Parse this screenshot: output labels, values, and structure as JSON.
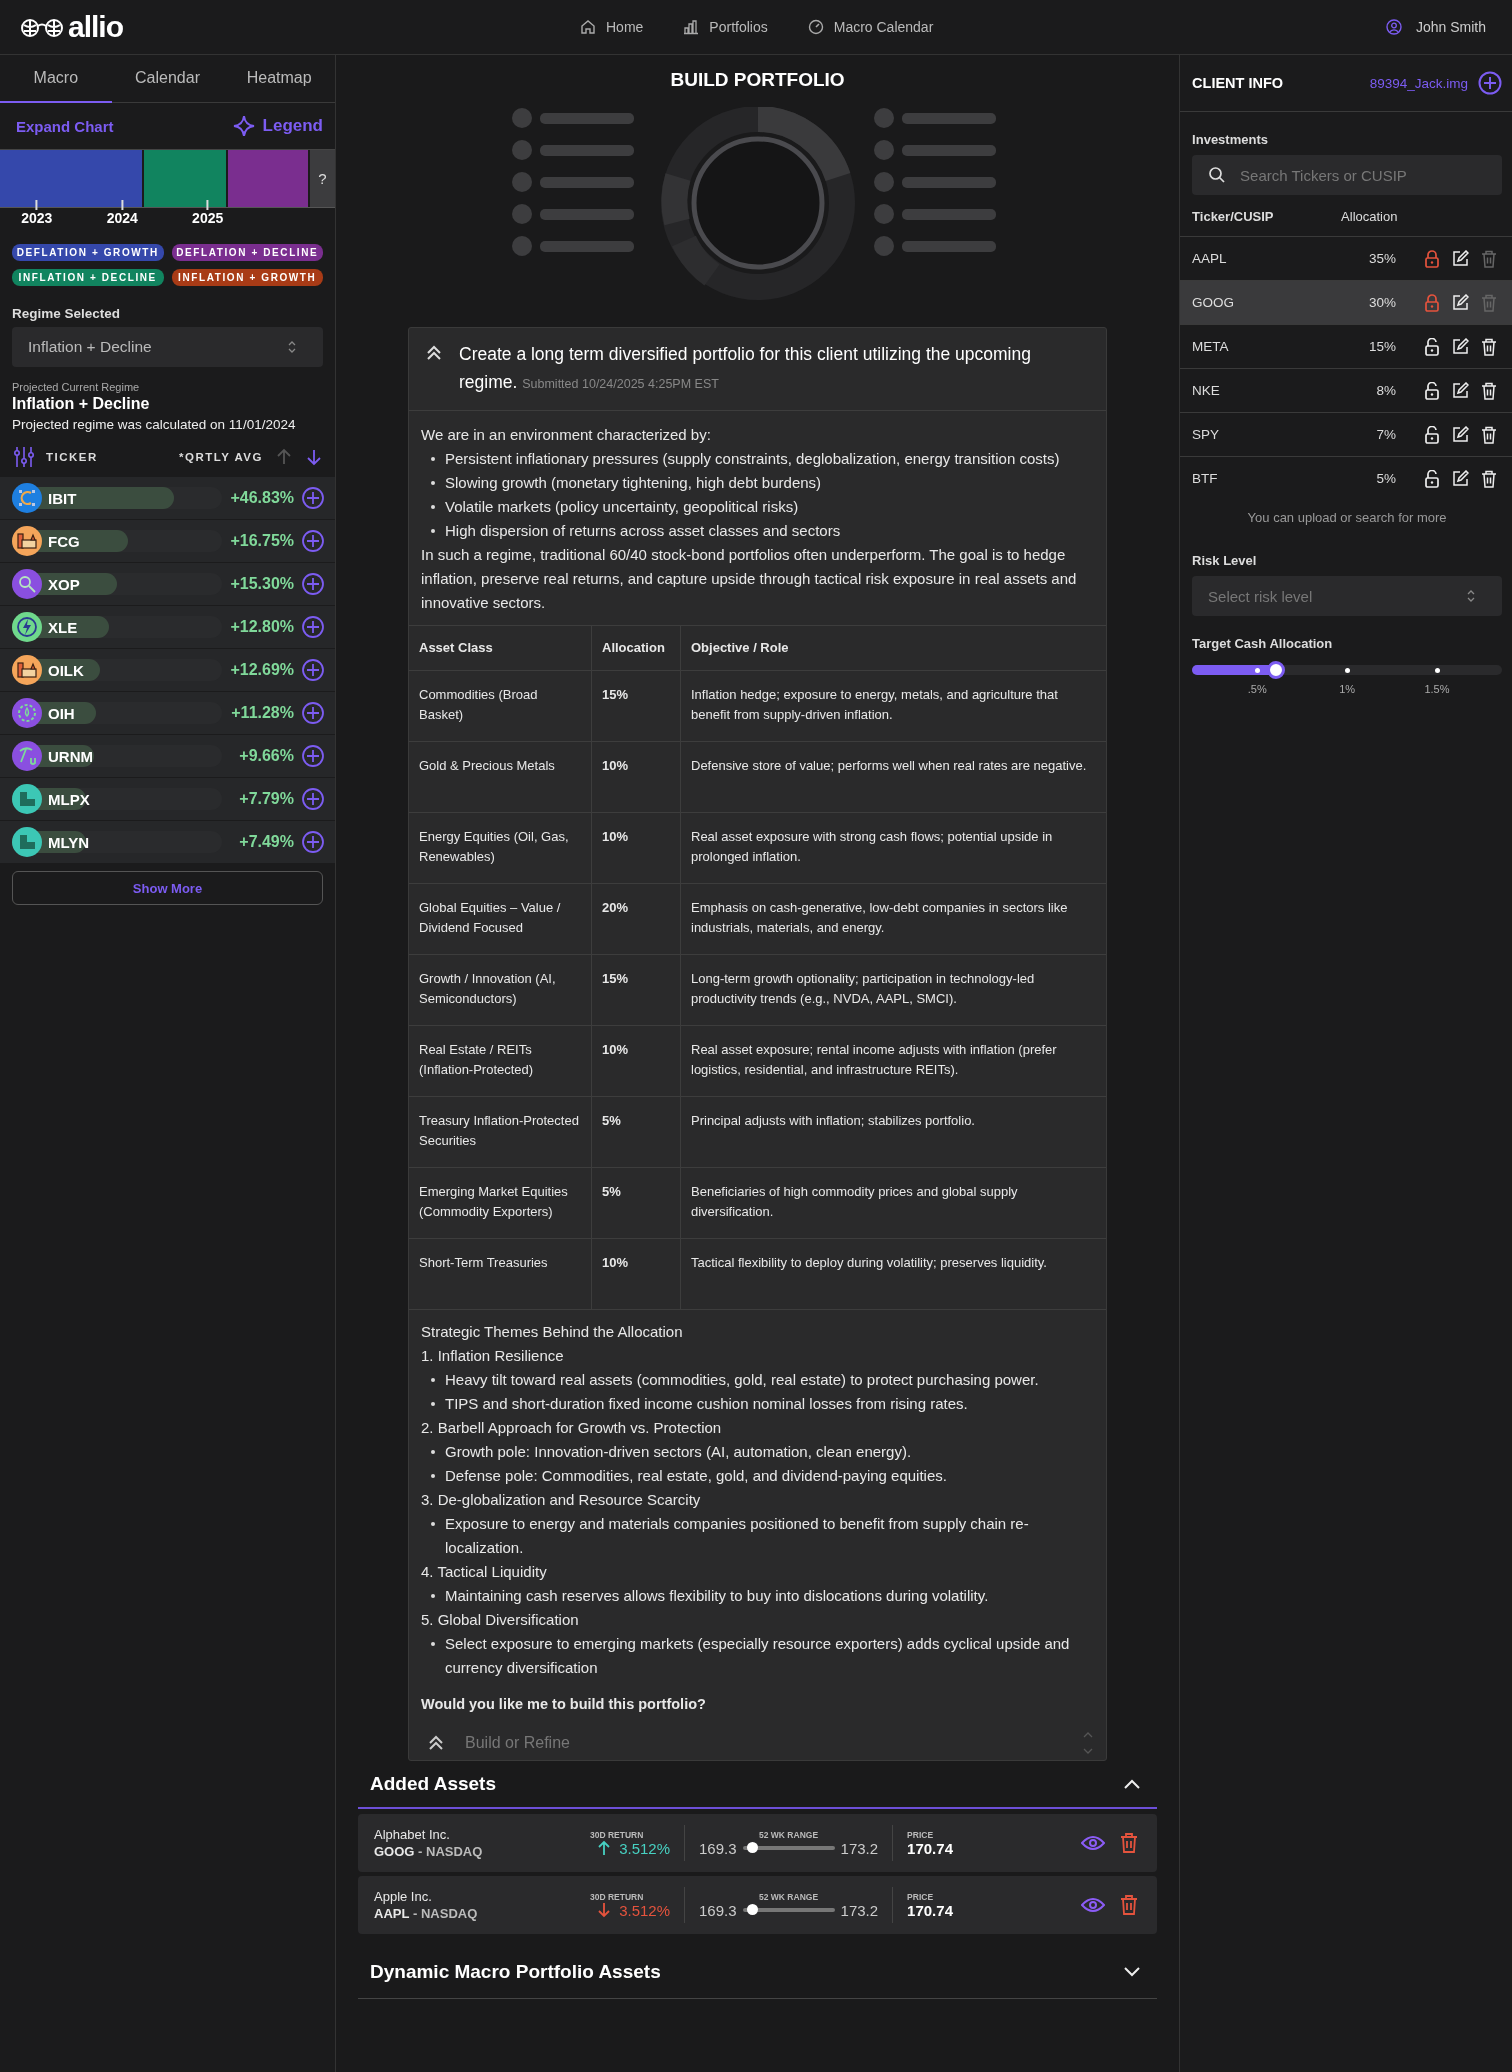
{
  "header": {
    "logo": "allio",
    "nav": [
      {
        "label": "Home",
        "kind": "home"
      },
      {
        "label": "Portfolios",
        "kind": "portfolios"
      },
      {
        "label": "Macro Calendar",
        "kind": "calendar"
      }
    ],
    "user": "John Smith"
  },
  "sidebar": {
    "tabs": [
      {
        "label": "Macro",
        "selected": true
      },
      {
        "label": "Calendar",
        "selected": false
      },
      {
        "label": "Heatmap",
        "selected": false
      }
    ],
    "expand_chart": "Expand Chart",
    "legend": "Legend",
    "regime_timeline": {
      "segments": [
        {
          "kind": "regime",
          "color": "#3548ab"
        },
        {
          "kind": "regime",
          "color": "#11845f"
        },
        {
          "kind": "regime",
          "color": "#7a2e8f"
        },
        {
          "kind": "unknown",
          "label": "?"
        }
      ],
      "years": [
        "2023",
        "2024",
        "2025"
      ]
    },
    "regimes": [
      {
        "label": "DEFLATION + GROWTH",
        "color": "#3548ab"
      },
      {
        "label": "DEFLATION + DECLINE",
        "color": "#7a2e8f"
      },
      {
        "label": "INFLATION + DECLINE",
        "color": "#11845f"
      },
      {
        "label": "INFLATION + GROWTH",
        "color": "#a83b16"
      }
    ],
    "regime_selected": {
      "label": "Regime Selected",
      "value": "Inflation + Decline"
    },
    "projected": {
      "label": "Projected Current Regime",
      "value": "Inflation + Decline",
      "note": "Projected regime was calculated on 11/01/2024"
    },
    "ticker_header": {
      "ticker": "TICKER",
      "average": "*QRTLY AVG",
      "sort_descending": true
    },
    "tickers": [
      {
        "symbol": "IBIT",
        "change": "+46.83%",
        "level": 0.77,
        "kind": "network",
        "color": "#1e7fe0"
      },
      {
        "symbol": "FCG",
        "change": "+16.75%",
        "level": 0.55,
        "kind": "factory",
        "color": "#f5a55a"
      },
      {
        "symbol": "XOP",
        "change": "+15.30%",
        "level": 0.5,
        "kind": "magnifier",
        "color": "#8a4fe0"
      },
      {
        "symbol": "XLE",
        "change": "+12.80%",
        "level": 0.46,
        "kind": "bolt",
        "color": "#6fd88c"
      },
      {
        "symbol": "OILK",
        "change": "+12.69%",
        "level": 0.42,
        "kind": "factory",
        "color": "#f5a55a"
      },
      {
        "symbol": "OIH",
        "change": "+11.28%",
        "level": 0.4,
        "kind": "gear",
        "color": "#8a4fe0"
      },
      {
        "symbol": "URNM",
        "change": "+9.66%",
        "level": 0.39,
        "kind": "pickaxe",
        "color": "#8a4fe0"
      },
      {
        "symbol": "MLPX",
        "change": "+7.79%",
        "level": 0.35,
        "kind": "buildings",
        "color": "#3cc7b5"
      },
      {
        "symbol": "MLYN",
        "change": "+7.49%",
        "level": 0.35,
        "kind": "buildings",
        "color": "#3cc7b5"
      }
    ],
    "show_more": "Show More"
  },
  "main": {
    "title": "BUILD PORTFOLIO",
    "prompt": {
      "text": "Create a long term diversified portfolio for this client utilizing the upcoming regime.",
      "submitted": "Submitted 10/24/2025 4:25PM EST"
    },
    "intro": "We are in an environment characterized by:",
    "bullets": [
      "Persistent inflationary pressures (supply constraints, deglobalization, energy transition costs)",
      "Slowing growth (monetary tightening, high debt burdens)",
      "Volatile markets (policy uncertainty, geopolitical risks)",
      "High dispersion of returns across asset classes and sectors"
    ],
    "paragraph": "In such a regime, traditional 60/40 stock-bond portfolios often underperform. The goal is to hedge inflation, preserve real returns, and capture upside through tactical risk exposure in real assets and innovative sectors.",
    "table": {
      "columns": [
        "Asset Class",
        "Allocation",
        "Objective / Role"
      ],
      "rows": [
        [
          "Commodities (Broad Basket)",
          "15%",
          "Inflation hedge; exposure to energy, metals, and agriculture that benefit from supply-driven inflation."
        ],
        [
          "Gold & Precious Metals",
          "10%",
          "Defensive store of value; performs well when real rates are negative."
        ],
        [
          "Energy Equities (Oil, Gas, Renewables)",
          "10%",
          "Real asset exposure with strong cash flows; potential upside in prolonged inflation."
        ],
        [
          "Global Equities – Value / Dividend Focused",
          "20%",
          "Emphasis on cash-generative, low-debt companies in sectors like industrials, materials, and energy."
        ],
        [
          "Growth / Innovation (AI, Semiconductors)",
          "15%",
          "Long-term growth optionality; participation in technology-led productivity trends (e.g., NVDA, AAPL, SMCI)."
        ],
        [
          "Real Estate / REITs (Inflation-Protected)",
          "10%",
          "Real asset exposure; rental income adjusts with inflation (prefer logistics, residential, and infrastructure REITs)."
        ],
        [
          "Treasury Inflation-Protected Securities",
          "5%",
          "Principal adjusts with inflation; stabilizes portfolio."
        ],
        [
          "Emerging Market Equities (Commodity Exporters)",
          "5%",
          "Beneficiaries of high commodity prices and global supply diversification."
        ],
        [
          "Short-Term Treasuries",
          "10%",
          "Tactical flexibility to deploy during volatility; preserves liquidity."
        ]
      ]
    },
    "themes_title": "Strategic Themes Behind the Allocation",
    "themes": [
      {
        "text": "1. Inflation Resilience",
        "children": [
          {
            "text": "Heavy tilt toward real assets (commodities, gold, real estate) to protect purchasing power."
          },
          {
            "text": "TIPS and short-duration fixed income cushion nominal losses from rising rates."
          }
        ]
      },
      {
        "text": "2. Barbell Approach for Growth vs. Protection",
        "children": [
          {
            "text": "Growth pole: Innovation-driven sectors (AI, automation, clean energy)."
          },
          {
            "text": "Defense pole: Commodities, real estate, gold, and dividend-paying equities."
          }
        ]
      },
      {
        "text": "3. De-globalization and Resource Scarcity",
        "children": [
          {
            "text": "Exposure to energy and materials companies positioned to benefit from supply chain re-localization."
          }
        ]
      },
      {
        "text": "4. Tactical Liquidity",
        "children": [
          {
            "text": "Maintaining cash reserves allows flexibility to buy into dislocations during volatility."
          }
        ]
      },
      {
        "text": "5. Global Diversification",
        "children": [
          {
            "text": "Select exposure to emerging markets (especially resource exporters) adds cyclical upside and currency diversification"
          }
        ]
      }
    ],
    "question": "Would you like me to build this portfolio?",
    "input": {
      "placeholder": "Build or Refine"
    },
    "added_assets": {
      "title": "Added Assets",
      "expanded": true,
      "assets": [
        {
          "name": "Alphabet Inc.",
          "ticker": "GOOG",
          "exchange": "- NASDAQ",
          "return_label": "30D RETURN",
          "return": "3.512%",
          "kind": "up",
          "range_label": "52 WK RANGE",
          "low": "169.3",
          "high": "173.2",
          "level": 0.1,
          "price_label": "PRICE",
          "price": "170.74"
        },
        {
          "name": "Apple Inc.",
          "ticker": "AAPL",
          "exchange": "- NASDAQ",
          "return_label": "30D RETURN",
          "return": "3.512%",
          "kind": "down",
          "range_label": "52 WK RANGE",
          "low": "169.3",
          "high": "173.2",
          "level": 0.1,
          "price_label": "PRICE",
          "price": "170.74"
        }
      ]
    },
    "dynamic_assets": {
      "title": "Dynamic Macro Portfolio Assets",
      "expanded": false
    }
  },
  "client": {
    "title": "CLIENT INFO",
    "file": "89394_Jack.img",
    "investments_label": "Investments",
    "search": {
      "placeholder": "Search Tickers or CUSIP"
    },
    "columns": [
      "Ticker/CUSIP",
      "Allocation"
    ],
    "holdings": [
      {
        "ticker": "AAPL",
        "allocation": "35%",
        "locked": true,
        "selected": false
      },
      {
        "ticker": "GOOG",
        "allocation": "30%",
        "locked": true,
        "selected": true
      },
      {
        "ticker": "META",
        "allocation": "15%",
        "locked": false,
        "selected": false
      },
      {
        "ticker": "NKE",
        "allocation": "8%",
        "locked": false,
        "selected": false
      },
      {
        "ticker": "SPY",
        "allocation": "7%",
        "locked": false,
        "selected": false
      },
      {
        "ticker": "BTF",
        "allocation": "5%",
        "locked": false,
        "selected": false
      }
    ],
    "note": "You can upload or search for more",
    "risk": {
      "label": "Risk Level",
      "placeholder": "Select risk level"
    },
    "cash": {
      "label": "Target Cash Allocation",
      "level": 0.27,
      "ticks": [
        ".5%",
        "1%",
        "1.5%"
      ]
    }
  }
}
